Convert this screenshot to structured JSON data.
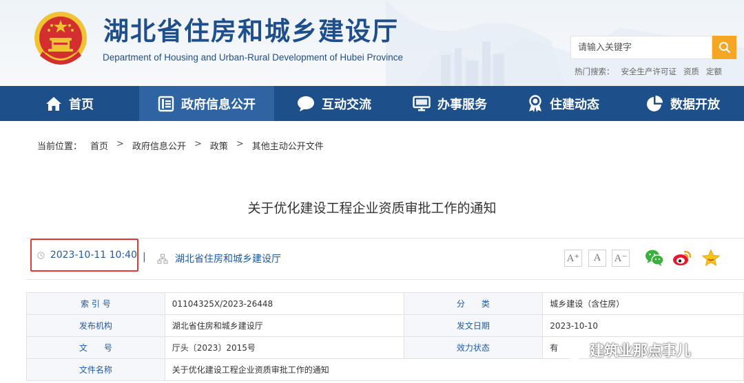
{
  "header": {
    "title": "湖北省住房和城乡建设厅",
    "subtitle": "Department of Housing and Urban-Rural Development of Hubei Province",
    "search_placeholder": "请输入关键字",
    "hot_label": "热门搜索：",
    "hot_terms": [
      "安全生产许可证",
      "资质",
      "定额"
    ]
  },
  "nav": {
    "items": [
      {
        "label": "首页",
        "icon": "home-icon"
      },
      {
        "label": "政府信息公开",
        "icon": "document-icon"
      },
      {
        "label": "互动交流",
        "icon": "chat-bubble-icon"
      },
      {
        "label": "办事服务",
        "icon": "monitor-icon"
      },
      {
        "label": "住建动态",
        "icon": "award-icon"
      },
      {
        "label": "数据开放",
        "icon": "pie-chart-icon"
      }
    ]
  },
  "breadcrumb": {
    "prefix": "当前位置：",
    "items": [
      "首页",
      "政府信息公开",
      "政策",
      "其他主动公开文件"
    ],
    "separator": ">"
  },
  "article": {
    "title": "关于优化建设工程企业资质审批工作的通知",
    "datetime": "2023-10-11 10:40",
    "pipe": "|",
    "source": "湖北省住房和城乡建设厅",
    "font_buttons": [
      "A⁺",
      "A",
      "A⁻"
    ]
  },
  "info_table": {
    "rows": [
      {
        "l1": "索 引 号",
        "v1": "01104325X/2023-26448",
        "l2": "分　　类",
        "v2": "城乡建设（含住房）"
      },
      {
        "l1": "发布机构",
        "v1": "湖北省住房和城乡建设厅",
        "l2": "发文日期",
        "v2": "2023-10-10"
      },
      {
        "l1": "文　　号",
        "v1": "厅头〔2023〕2015号",
        "l2": "效力状态",
        "v2": "有"
      },
      {
        "l1": "文件名称",
        "v1": "关于优化建设工程企业资质审批工作的通知",
        "l2": "",
        "v2": ""
      }
    ]
  },
  "watermark": {
    "text": "建筑业那点事儿",
    "icon": "wechat-icon"
  },
  "colors": {
    "nav_bg": "#1d4f8a",
    "nav_active": "#2f64a3",
    "brand_blue": "#1e4e8c",
    "link_blue": "#1f5aa6",
    "search_btn": "#f5a623",
    "highlight_red": "#e53935"
  }
}
